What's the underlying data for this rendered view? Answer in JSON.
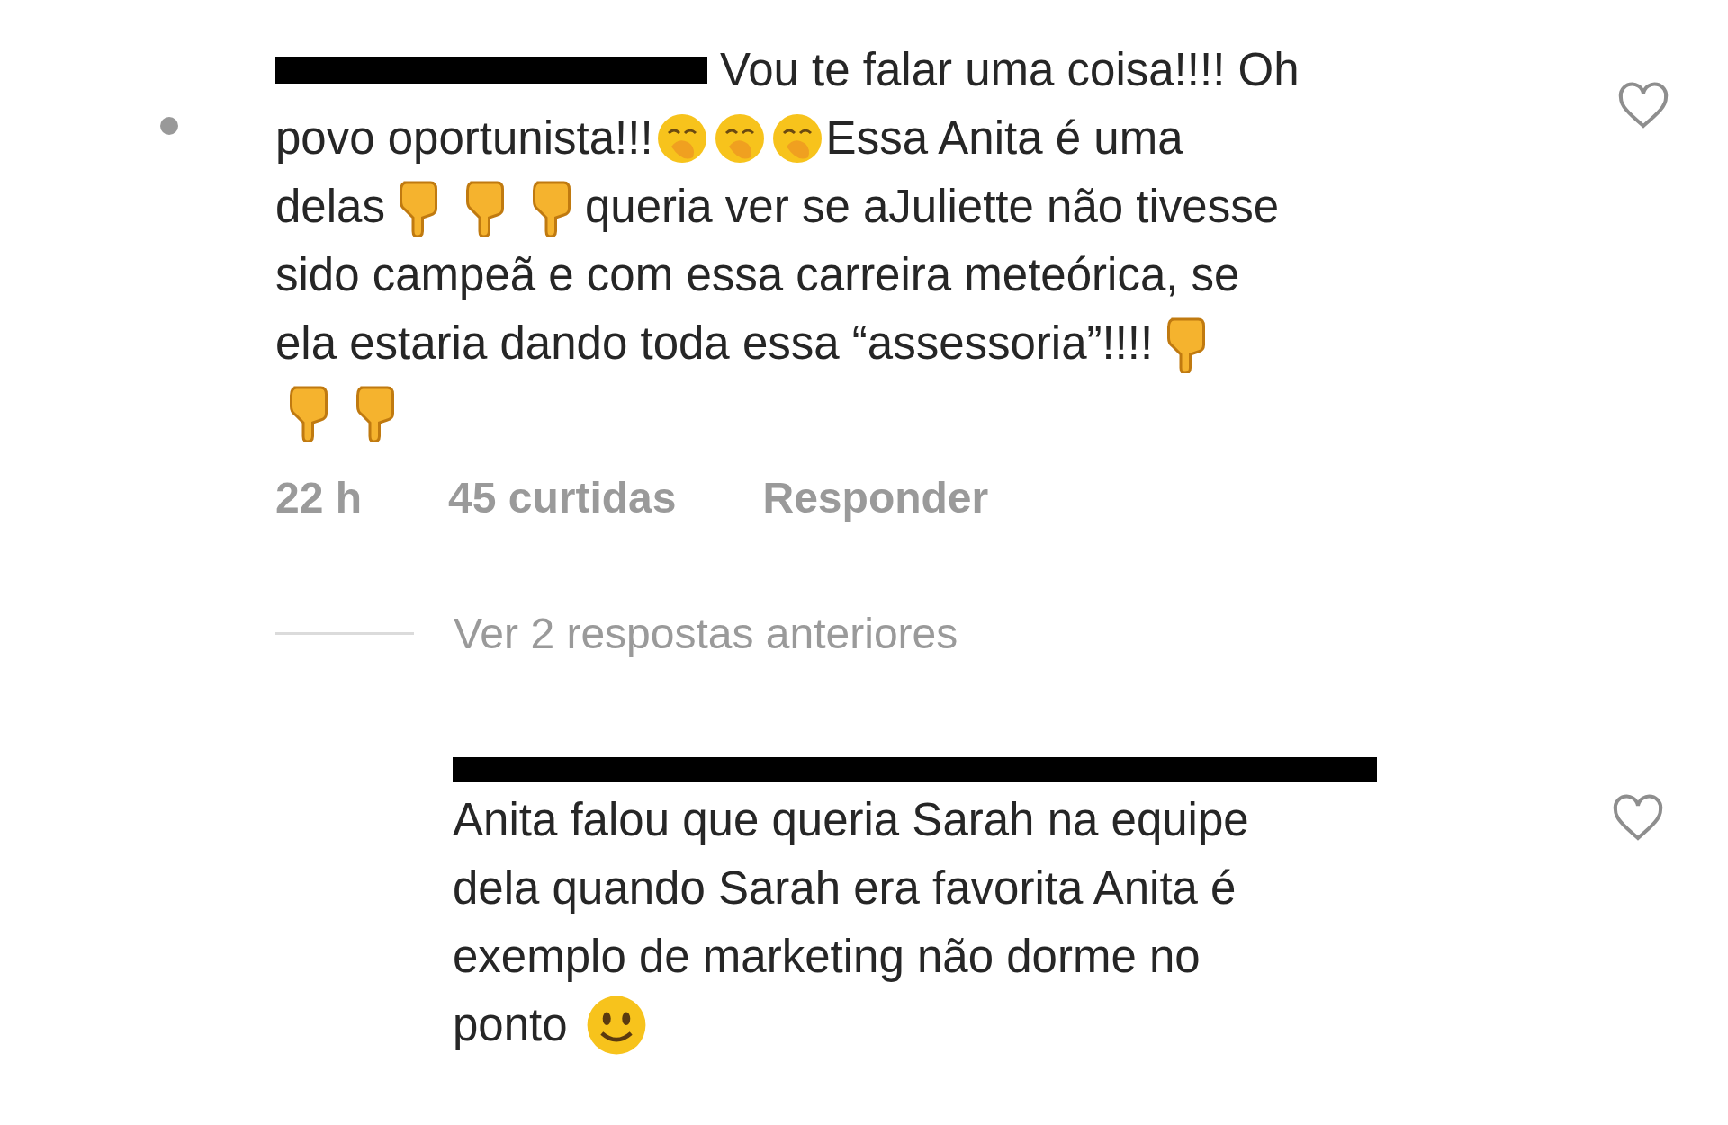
{
  "comments": [
    {
      "liked": false,
      "lines": [
        [
          {
            "kind": "redacted"
          },
          {
            "kind": "text",
            "text": "Vou te falar uma coisa!!!! Oh"
          }
        ],
        [
          {
            "kind": "text",
            "text": "povo oportunista!!!"
          },
          {
            "kind": "face-hand"
          },
          {
            "kind": "face-hand"
          },
          {
            "kind": "face-hand"
          },
          {
            "kind": "text",
            "text": "Essa Anita é uma"
          }
        ],
        [
          {
            "kind": "text",
            "text": "delas"
          },
          {
            "kind": "thumbs-down"
          },
          {
            "kind": "thumbs-down"
          },
          {
            "kind": "thumbs-down"
          },
          {
            "kind": "text",
            "text": "queria ver se aJuliette não tivesse"
          }
        ],
        [
          {
            "kind": "text",
            "text": "sido campeã e com essa carreira meteórica, se"
          }
        ],
        [
          {
            "kind": "text",
            "text": "ela estaria dando toda essa “assessoria”!!!!"
          },
          {
            "kind": "thumbs-down"
          }
        ],
        [
          {
            "kind": "thumbs-down"
          },
          {
            "kind": "thumbs-down"
          }
        ]
      ],
      "time": "22 h",
      "likes": "45 curtidas",
      "reply": "Responder"
    }
  ],
  "view_replies": "Ver 2 respostas anteriores",
  "replies": [
    {
      "liked": false,
      "lines": [
        [
          {
            "kind": "text",
            "text": "Anita falou que queria Sarah na equipe"
          }
        ],
        [
          {
            "kind": "text",
            "text": "dela quando Sarah era favorita Anita é"
          }
        ],
        [
          {
            "kind": "text",
            "text": "exemplo de marketing não dorme no"
          }
        ],
        [
          {
            "kind": "text",
            "text": "ponto"
          },
          {
            "kind": "smile"
          }
        ]
      ]
    }
  ]
}
